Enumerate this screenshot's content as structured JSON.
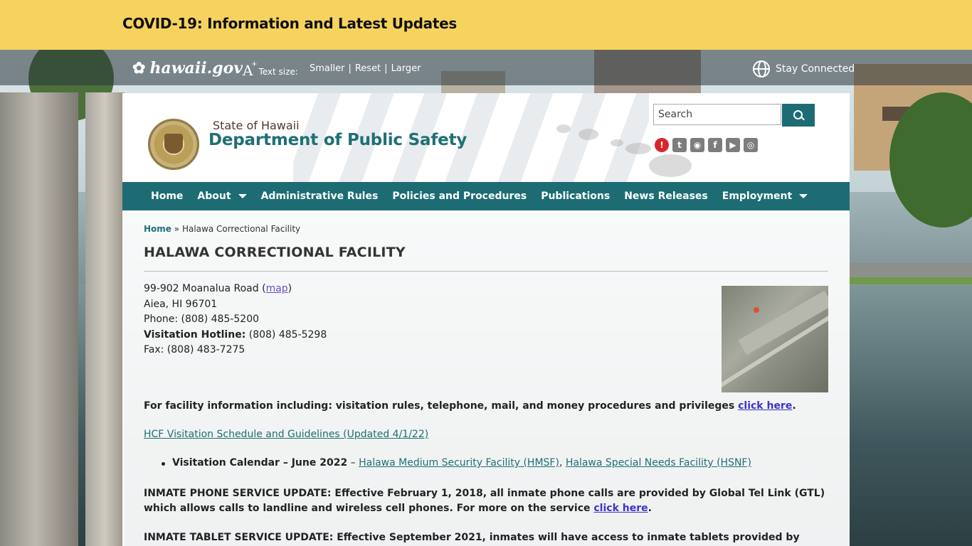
{
  "banner": {
    "covid_link": "COVID-19: Information and Latest Updates"
  },
  "topbar": {
    "portal_logo": "hawaii.gov",
    "text_size_label": "Text size:",
    "size_links": [
      "Smaller",
      "Reset",
      "Larger"
    ],
    "stay_connected": "Stay Connected"
  },
  "header": {
    "state_name": "State of Hawaii",
    "department": "Department of Public Safety",
    "search": {
      "placeholder": "Search"
    },
    "social_icons": [
      "alert-icon",
      "twitter-icon",
      "rss-icon",
      "facebook-icon",
      "youtube-icon",
      "instagram-icon"
    ]
  },
  "nav": {
    "items": [
      {
        "label": "Home",
        "dropdown": false
      },
      {
        "label": "About",
        "dropdown": true
      },
      {
        "label": "Administrative Rules",
        "dropdown": false
      },
      {
        "label": "Policies and Procedures",
        "dropdown": false
      },
      {
        "label": "Publications",
        "dropdown": false
      },
      {
        "label": "News Releases",
        "dropdown": false
      },
      {
        "label": "Employment",
        "dropdown": true
      }
    ]
  },
  "content": {
    "breadcrumb": {
      "home": "Home",
      "separator": "»",
      "current": "Halawa Correctional Facility"
    },
    "title": "HALAWA CORRECTIONAL FACILITY",
    "address": {
      "street": "99-902 Moanalua Road (",
      "map_link": "map",
      "street_end": ")",
      "city": "Aiea, HI 96701",
      "phone": "Phone: (808) 485-5200",
      "visitation_label": "Visitation Hotline:",
      "visitation_number": " (808) 485-5298",
      "fax": "Fax: (808) 483-7275"
    },
    "facility_info": {
      "text": "For facility information including: visitation rules, telephone, mail, and money procedures and privileges ",
      "link": "click here",
      "end": "."
    },
    "schedule_link": "HCF Visitation Schedule and Guidelines (Updated 4/1/22)",
    "calendar": {
      "label": "Visitation Calendar – June 2022",
      "dash": " – ",
      "link1": "Halawa Medium Security Facility (HMSF)",
      "comma": ", ",
      "link2": "Halawa Special Needs Facility (HSNF)"
    },
    "phone_update": {
      "text": "INMATE PHONE SERVICE UPDATE: Effective February 1, 2018, all inmate phone calls are provided by Global Tel Link (GTL) which allows calls to landline and wireless cell phones. For more on the service ",
      "link": "click here",
      "end": "."
    },
    "tablet_update": "INMATE TABLET SERVICE UPDATE: Effective September 2021, inmates will have access to inmate tablets provided by Global Tel Link (GTL)"
  },
  "colors": {
    "banner": "#f6d35f",
    "brand_teal": "#1d6c74",
    "link_purple": "#3b33c9"
  }
}
